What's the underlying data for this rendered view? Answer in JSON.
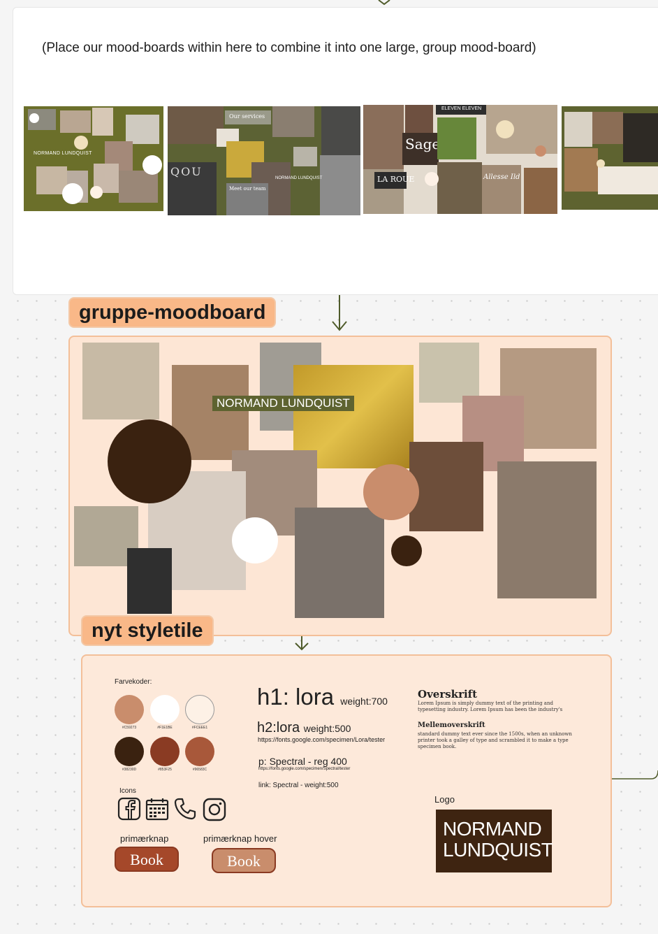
{
  "top_frame": {
    "instruction": "(Place our mood-boards within here to combine it into one large, group mood-board)",
    "boards": [
      {
        "logo_text": "NORMAND LUNDQUIST"
      },
      {
        "services": "Our services",
        "team": "Meet our team",
        "logo_text": "NORMAND LUNDQUIST",
        "magazine": "QOU"
      },
      {
        "brand1": "ELEVEN ELEVEN",
        "brand2": "Sage",
        "brand3": "LA ROUE",
        "brand4": "Allesse Ild"
      },
      {}
    ]
  },
  "labels": {
    "group": "gruppe-moodboard",
    "styletile": "nyt styletile"
  },
  "group_board": {
    "logo_text": "NORMAND LUNDQUIST"
  },
  "styletile": {
    "colors_title": "Farvekoder:",
    "swatches": [
      {
        "hex": "#C59273",
        "color": "#c98d6c"
      },
      {
        "hex": "#F1E1BE",
        "color": "#ffffff"
      },
      {
        "hex": "#FCEEE1",
        "color": "#fdf1e6"
      },
      {
        "hex": "#38230D",
        "color": "#3a2210"
      },
      {
        "hex": "#853F25",
        "color": "#8a3b23"
      },
      {
        "hex": "#96583C",
        "color": "#a8583a"
      }
    ],
    "h1_label": "h1: lora",
    "h1_weight": "weight:700",
    "h2_label": "h2:lora",
    "h2_weight": "weight:500",
    "lora_url": "https://fonts.google.com/specimen/Lora/tester",
    "p_label": "p: Spectral - reg 400",
    "spectral_url": "https://fonts.google.com/specimen/Spectral/tester",
    "link_label": "link: Spectral - weight:500",
    "sample_heading": "Overskrift",
    "sample_body1": "Lorem Ipsum is simply dummy text of the printing and typesetting industry. Lorem Ipsum has been the industry's",
    "sample_subheading": "Mellemoverskrift",
    "sample_body2": "standard dummy text ever since the 1500s, when an unknown printer took a galley of type and scrambled it to make a type specimen book.",
    "icons_label": "Icons",
    "icons": [
      "facebook-icon",
      "calendar-icon",
      "phone-icon",
      "instagram-icon"
    ],
    "primary_label": "primærknap",
    "primary_text": "Book",
    "hover_label": "primærknap hover",
    "hover_text": "Book",
    "logo_label": "Logo",
    "logo_line1": "NORMAND",
    "logo_line2": "LUNDQUIST",
    "primary_color": "#a5482a",
    "hover_color": "#c98d6c"
  }
}
